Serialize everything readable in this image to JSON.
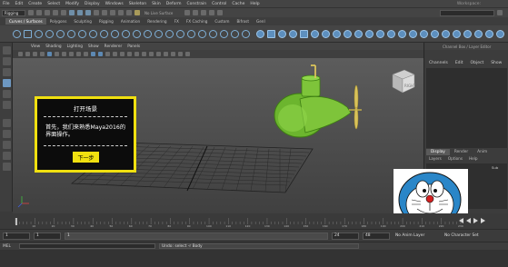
{
  "menubar": {
    "items": [
      "File",
      "Edit",
      "Create",
      "Select",
      "Modify",
      "Display",
      "Windows",
      "Skeleton",
      "Skin",
      "Deform",
      "Constrain",
      "Control",
      "Cache",
      "Help"
    ],
    "right_label": "Workspace:"
  },
  "statusline": {
    "mode": "Rigging",
    "surface": "No Live Surface"
  },
  "shelf_tabs": [
    "Curves / Surfaces",
    "Polygons",
    "Sculpting",
    "Rigging",
    "Animation",
    "Rendering",
    "FX",
    "FX Caching",
    "Custom",
    "Bifrost",
    "GenI"
  ],
  "shelf_active": "Curves / Surfaces",
  "viewport_menu": [
    "View",
    "Shading",
    "Lighting",
    "Show",
    "Renderer",
    "Panels"
  ],
  "viewcube_label": "RIGHT",
  "right_panel": {
    "title": "Channel Box / Layer Editor",
    "menu": [
      "Channels",
      "Edit",
      "Object",
      "Show"
    ],
    "tabs": [
      "Display",
      "Render",
      "Anim"
    ],
    "active_tab": "Display",
    "sub_menu": [
      "Layers",
      "Options",
      "Help"
    ],
    "layer_name": "Sub"
  },
  "timeline": {
    "ticks": [
      "10",
      "20",
      "30",
      "40",
      "50",
      "60",
      "70",
      "80",
      "90",
      "100",
      "110",
      "120",
      "130",
      "140",
      "150",
      "160",
      "170",
      "180",
      "190",
      "200",
      "210",
      "220",
      "230"
    ]
  },
  "range": {
    "start": "1",
    "playback_start": "1",
    "anim_start": "1",
    "playback_end": "24",
    "anim_end": "48",
    "anim_layer": "No Anim Layer",
    "char_set": "No Character Set"
  },
  "cmdline": {
    "lang": "MEL",
    "result": "Undo: select -r Body"
  },
  "popup": {
    "title": "打开场景",
    "body": "首先，我们来熟悉Maya2016的界面操作。",
    "button": "下一步"
  },
  "colors": {
    "popup_border": "#f0e010",
    "model": "#7ec43a",
    "accent_blue": "#5d8fbe"
  }
}
